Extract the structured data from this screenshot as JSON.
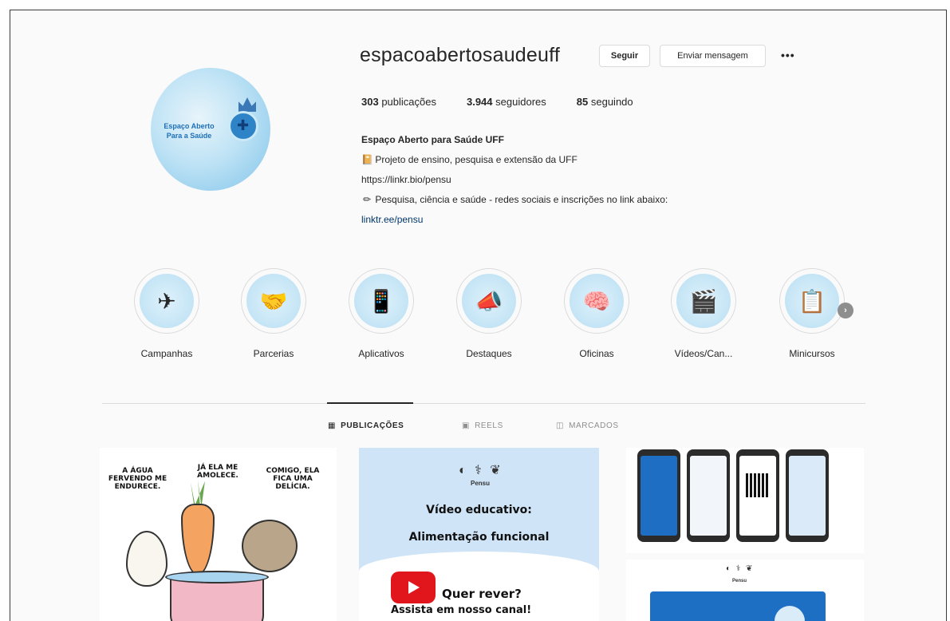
{
  "profile": {
    "username": "espacoabertosaudeuff",
    "follow_label": "Seguir",
    "message_label": "Enviar mensagem",
    "more_label": "•••",
    "avatar_text": "Espaço Aberto Para a Saúde",
    "stats": {
      "posts_count": "303",
      "posts_label": "publicações",
      "followers_count": "3.944",
      "followers_label": "seguidores",
      "following_count": "85",
      "following_label": "seguindo"
    },
    "bio": {
      "name": "Espaço Aberto para Saúde UFF",
      "line1": "Projeto de ensino, pesquisa e extensão da UFF",
      "line2": "https://linkr.bio/pensu",
      "line3": "Pesquisa, ciência e saúde - redes sociais e inscrições no link abaixo:",
      "link": "linktr.ee/pensu"
    }
  },
  "highlights": [
    {
      "label": "Campanhas",
      "icon": "✈"
    },
    {
      "label": "Parcerias",
      "icon": "🤝"
    },
    {
      "label": "Aplicativos",
      "icon": "📱"
    },
    {
      "label": "Destaques",
      "icon": "📣"
    },
    {
      "label": "Oficinas",
      "icon": "🧠"
    },
    {
      "label": "Vídeos/Can...",
      "icon": "🎬"
    },
    {
      "label": "Minicursos",
      "icon": "📋"
    }
  ],
  "tabs": {
    "posts": "PUBLICAÇÕES",
    "reels": "REELS",
    "tagged": "MARCADOS"
  },
  "posts": {
    "p1": {
      "t1": "A ÁGUA FERVENDO ME ENDURECE.",
      "t2": "JÁ ELA ME AMOLECE.",
      "t3": "COMIGO, ELA FICA UMA DELÍCIA."
    },
    "p2": {
      "logo": "Pensu",
      "title1": "Vídeo educativo:",
      "title2": "Alimentação funcional",
      "cta1": "Quer rever?",
      "cta2": "Assista em nosso canal!"
    },
    "p4": {
      "logo": "Pensu"
    }
  },
  "colors": {
    "accent_blue": "#1d6fc4",
    "link": "#00376b",
    "border": "#dbdbdb",
    "youtube_red": "#e0161c"
  }
}
